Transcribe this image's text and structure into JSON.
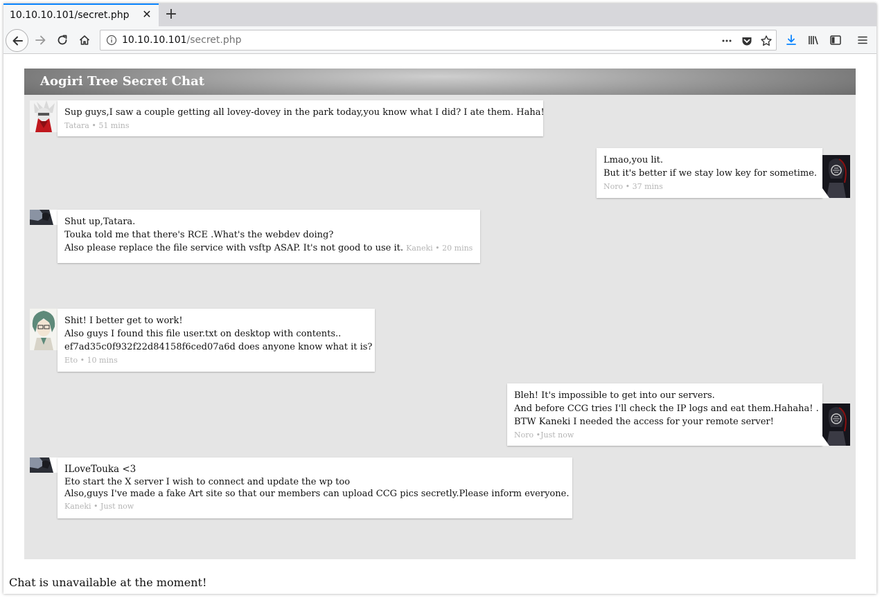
{
  "browser": {
    "tab_title": "10.10.10.101/secret.php",
    "url_host": "10.10.10.101",
    "url_path": "/secret.php"
  },
  "page": {
    "chat_title": "Aogiri Tree Secret Chat",
    "footer": "Chat is unavailable at the moment!"
  },
  "messages": [
    {
      "lines": [
        "Sup guys,I saw a couple getting all lovey-dovey in the park today,you know what I did? I ate them. Haha!"
      ],
      "meta": "Tatara • 51 mins"
    },
    {
      "lines": [
        "Lmao,you lit.",
        "But it's better if we stay low key for sometime."
      ],
      "meta": "Noro • 37 mins"
    },
    {
      "lines": [
        "Shut up,Tatara.",
        "Touka told me that there's RCE .What's the webdev doing?",
        "Also please replace the file service with vsftp ASAP. It's not good to use it."
      ],
      "meta": "Kaneki • 20 mins"
    },
    {
      "lines": [
        "Shit! I better get to work!",
        "Also guys I found this file user.txt on desktop with contents..",
        "ef7ad35c0f932f22d84158f6ced07a6d does anyone know what it is?"
      ],
      "meta": "Eto • 10 mins"
    },
    {
      "lines": [
        "Bleh! It's impossible to get into our servers.",
        "And before CCG tries I'll check the IP logs and eat them.Hahaha! .",
        "BTW Kaneki I needed the access for your remote server!"
      ],
      "meta": "Noro •Just now"
    },
    {
      "lines": [
        "ILoveTouka <3",
        "Eto start the X server I wish to connect and update the wp too",
        "Also,guys I've made a fake Art site so that our members can upload CCG pics secretly.Please inform everyone."
      ],
      "meta": "Kaneki • Just now"
    }
  ]
}
